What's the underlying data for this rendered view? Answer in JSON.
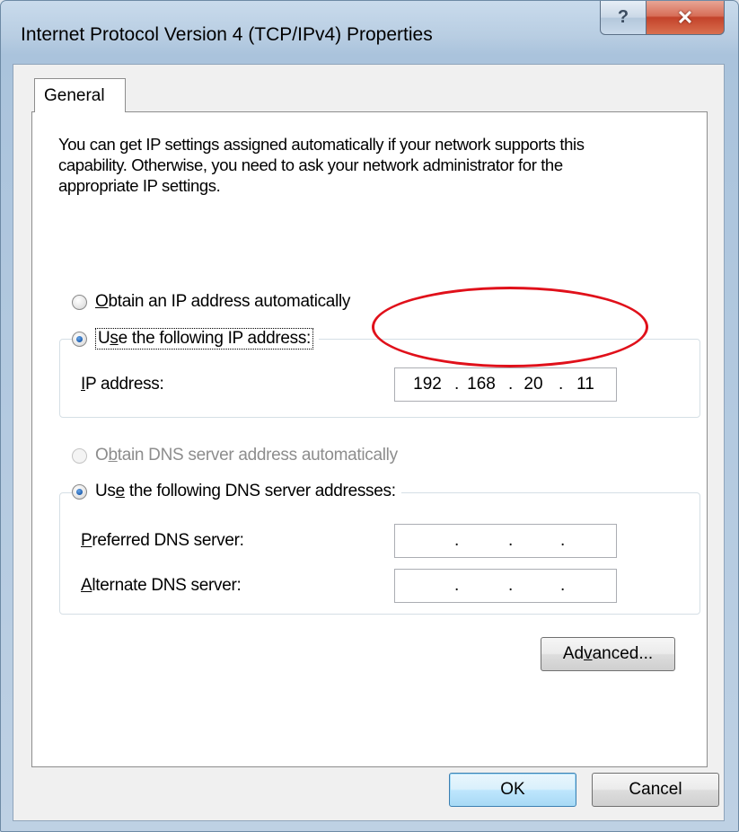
{
  "window": {
    "title": "Internet Protocol Version 4 (TCP/IPv4) Properties",
    "help_glyph": "?",
    "close_glyph": "✕"
  },
  "tabs": [
    {
      "label": "General",
      "selected": true
    }
  ],
  "description": "You can get IP settings assigned automatically if your network supports this capability. Otherwise, you need to ask your network administrator for the appropriate IP settings.",
  "ip_section": {
    "auto_option": {
      "mnemonic": "O",
      "rest": "btain an IP address automatically",
      "checked": false
    },
    "manual_option": {
      "mnemonic": "s",
      "pre": "U",
      "rest": "e the following IP address:",
      "checked": true
    },
    "ip_address": {
      "label_mnemonic": "I",
      "label_rest": "P address:",
      "octets": [
        "192",
        "168",
        "20",
        "11"
      ]
    }
  },
  "dns_section": {
    "auto_option": {
      "pre": "O",
      "mnemonic": "b",
      "rest": "tain DNS server address automatically",
      "checked": false,
      "disabled": true
    },
    "manual_option": {
      "pre": "Us",
      "mnemonic": "e",
      "rest": " the following DNS server addresses:",
      "checked": true
    },
    "preferred": {
      "label_mnemonic": "P",
      "label_rest": "referred DNS server:",
      "octets": [
        "",
        "",
        "",
        ""
      ]
    },
    "alternate": {
      "label_mnemonic": "A",
      "label_rest": "lternate DNS server:",
      "octets": [
        "",
        "",
        "",
        ""
      ]
    }
  },
  "buttons": {
    "advanced": {
      "pre": "Ad",
      "mnemonic": "v",
      "rest": "anced..."
    },
    "ok": "OK",
    "cancel": "Cancel"
  },
  "colors": {
    "annotation": "#e0101a",
    "radio_selected": "#1f5fb0",
    "close_button": "#c3422a"
  }
}
